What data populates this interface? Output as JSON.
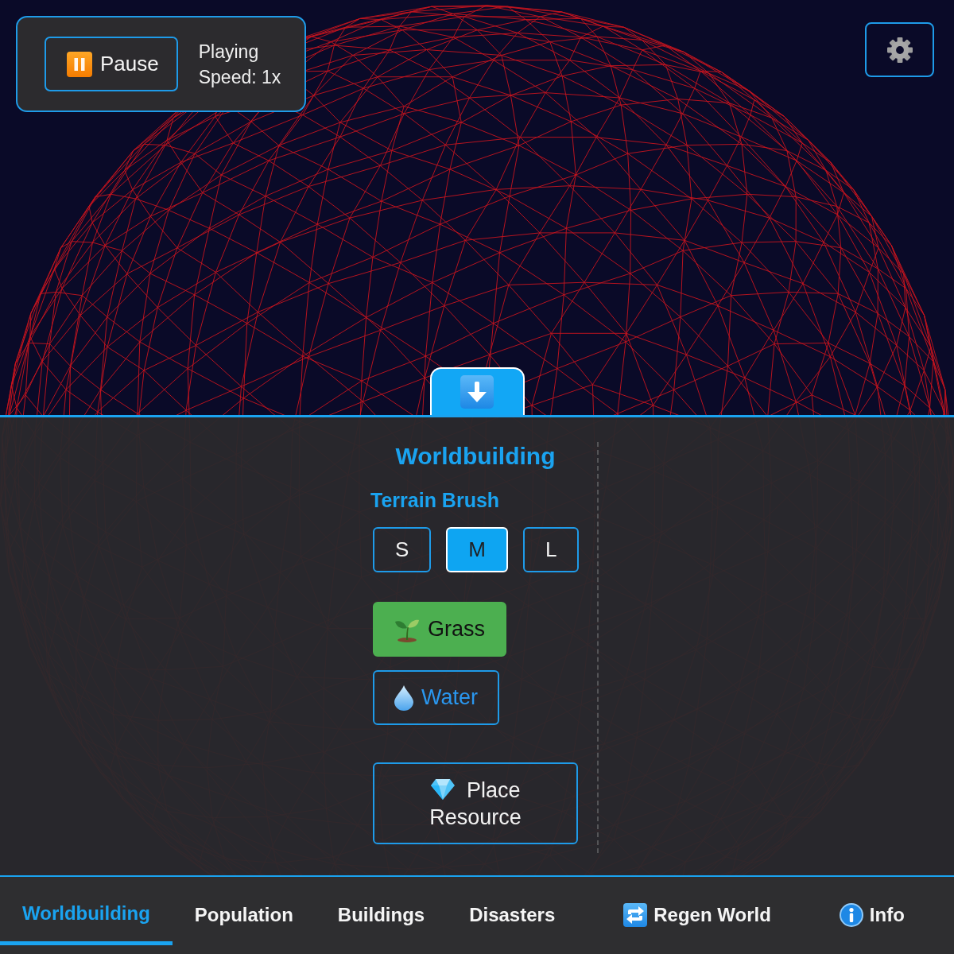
{
  "playback": {
    "button": {
      "label": "Pause"
    },
    "status": "Playing",
    "speed": "Speed: 1x"
  },
  "drawer": {
    "expanded": true
  },
  "panel": {
    "title": "Worldbuilding",
    "section": "Terrain Brush",
    "brush_sizes": [
      {
        "label": "S",
        "selected": false
      },
      {
        "label": "M",
        "selected": true
      },
      {
        "label": "L",
        "selected": false
      }
    ],
    "terrains": [
      {
        "label": "Grass",
        "kind": "grass",
        "selected": true
      },
      {
        "label": "Water",
        "kind": "water",
        "selected": false
      }
    ],
    "action": {
      "label": "Place Resource",
      "kind": "gem"
    }
  },
  "tabs": [
    {
      "label": "Worldbuilding",
      "selected": true
    },
    {
      "label": "Population",
      "selected": false
    },
    {
      "label": "Buildings",
      "selected": false
    },
    {
      "label": "Disasters",
      "selected": false
    }
  ],
  "actions": [
    {
      "label": "Regen World",
      "kind": "regen"
    },
    {
      "label": "Info",
      "kind": "info"
    }
  ]
}
